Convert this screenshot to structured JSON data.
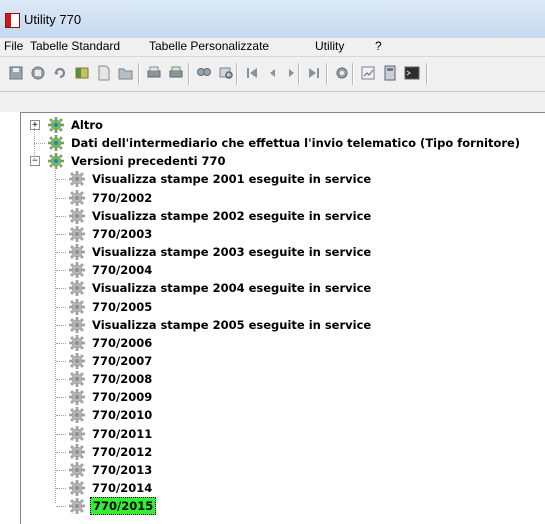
{
  "window": {
    "title": "Utility 770"
  },
  "menu": [
    "File",
    "Tabelle Standard",
    "Tabelle Personalizzate",
    "Utility",
    "?"
  ],
  "toolbar": {
    "buttons": [
      "save-icon",
      "stop-icon",
      "refresh-icon",
      "table-icon",
      "new-document-icon",
      "open-folder-icon",
      "print-icon",
      "print-preview-icon",
      "find-icon",
      "search-record-icon",
      "first-record-icon",
      "prev-record-icon",
      "next-record-icon",
      "last-record-icon",
      "gear-tool-icon",
      "chart-icon",
      "calculator-icon",
      "terminal-icon"
    ]
  },
  "tree": {
    "root_items": [
      {
        "label": "Altro",
        "expander": "+"
      },
      {
        "label": "Dati dell'intermediario che effettua l'invio telematico (Tipo fornitore)",
        "expander": ""
      },
      {
        "label": "Versioni precedenti 770",
        "expander": "−"
      }
    ],
    "children": [
      "Visualizza stampe 2001 eseguite in service",
      "770/2002",
      "Visualizza stampe 2002 eseguite in service",
      "770/2003",
      "Visualizza stampe 2003 eseguite in service",
      "770/2004",
      "Visualizza stampe 2004 eseguite in service",
      "770/2005",
      "Visualizza stampe 2005 eseguite in service",
      "770/2006",
      "770/2007",
      "770/2008",
      "770/2009",
      "770/2010",
      "770/2011",
      "770/2012",
      "770/2013",
      "770/2014",
      "770/2015"
    ],
    "selected": "770/2015",
    "selected_color": "#33ee33"
  }
}
